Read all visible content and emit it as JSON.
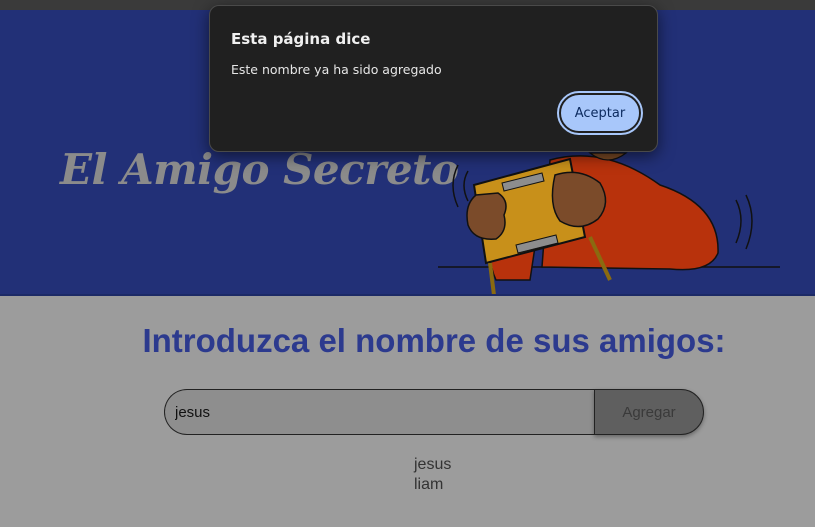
{
  "hero": {
    "title": "El Amigo Secreto"
  },
  "main": {
    "heading": "Introduzca el nombre de sus amigos:",
    "input_value": "jesus",
    "add_button_label": "Agregar",
    "friends": [
      "jesus",
      "liam"
    ]
  },
  "dialog": {
    "title": "Esta página dice",
    "message": "Este nombre ya ha sido agregado",
    "accept_label": "Aceptar"
  },
  "colors": {
    "hero_bg": "#223077",
    "heading": "#2c3a8e",
    "page_bg": "#9c9c9c",
    "dialog_bg": "#202020",
    "accept_button": "#a8c7fa"
  },
  "icons": {
    "hero_illustration": "person-holding-gift-box-illustration"
  }
}
